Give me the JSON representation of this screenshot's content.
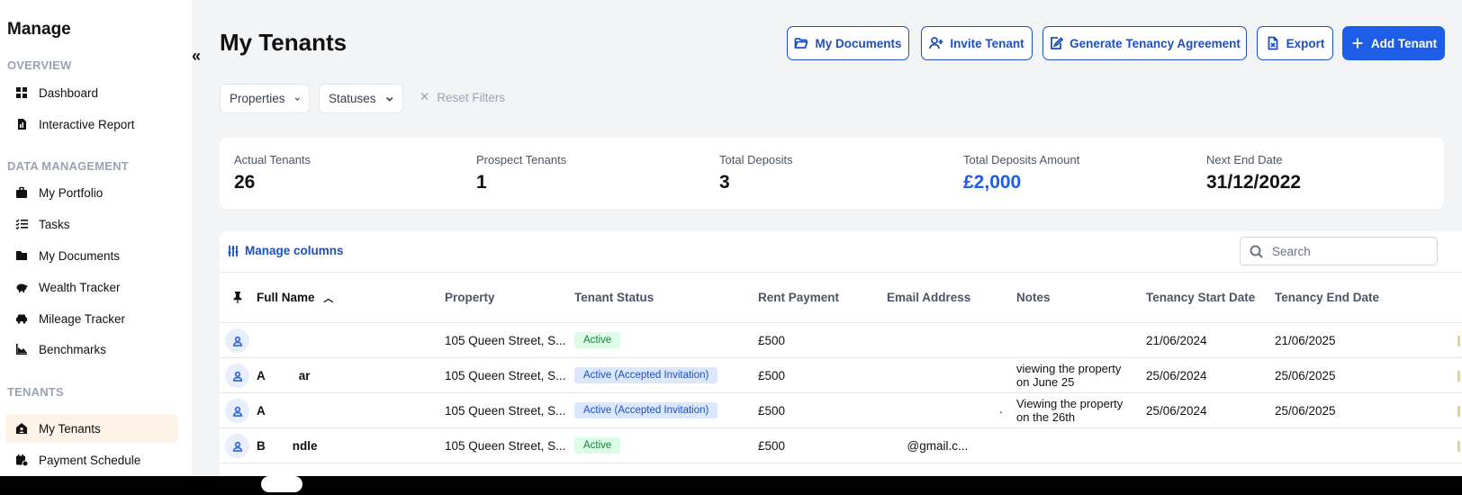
{
  "sidebar": {
    "title": "Manage",
    "sections": {
      "overview": "OVERVIEW",
      "data_management": "DATA MANAGEMENT",
      "tenants": "TENANTS"
    },
    "items": [
      {
        "label": "Dashboard",
        "icon": "grid-icon"
      },
      {
        "label": "Interactive Report",
        "icon": "report-icon"
      },
      {
        "label": "My Portfolio",
        "icon": "briefcase-icon"
      },
      {
        "label": "Tasks",
        "icon": "tasks-icon"
      },
      {
        "label": "My Documents",
        "icon": "folder-icon"
      },
      {
        "label": "Wealth Tracker",
        "icon": "piggy-bank-icon"
      },
      {
        "label": "Mileage Tracker",
        "icon": "car-icon"
      },
      {
        "label": "Benchmarks",
        "icon": "chart-icon"
      },
      {
        "label": "My Tenants",
        "icon": "home-user-icon"
      },
      {
        "label": "Payment Schedule",
        "icon": "calendar-icon"
      }
    ],
    "collapse_glyph": "«"
  },
  "header": {
    "title": "My Tenants",
    "buttons": {
      "my_documents": "My Documents",
      "invite_tenant": "Invite Tenant",
      "generate_agreement": "Generate Tenancy Agreement",
      "export": "Export",
      "add_tenant": "Add Tenant"
    }
  },
  "filters": {
    "properties": "Properties",
    "statuses": "Statuses",
    "reset": "Reset Filters"
  },
  "stats": [
    {
      "label": "Actual Tenants",
      "value": "26"
    },
    {
      "label": "Prospect Tenants",
      "value": "1"
    },
    {
      "label": "Total Deposits",
      "value": "3"
    },
    {
      "label": "Total Deposits Amount",
      "value": "£2,000"
    },
    {
      "label": "Next End Date",
      "value": "31/12/2022"
    }
  ],
  "table": {
    "manage_columns": "Manage columns",
    "search_placeholder": "Search",
    "columns": {
      "full_name": "Full Name",
      "property": "Property",
      "tenant_status": "Tenant Status",
      "rent_payment": "Rent Payment",
      "email": "Email Address",
      "notes": "Notes",
      "start_date": "Tenancy Start Date",
      "end_date": "Tenancy End Date"
    },
    "rows": [
      {
        "name": "",
        "property": "105 Queen Street, S...",
        "status": "Active",
        "rent": "£500",
        "email": "",
        "notes": [
          "",
          ""
        ],
        "start": "21/06/2024",
        "end": "21/06/2025"
      },
      {
        "name": "A          ar",
        "property": "105 Queen Street, S...",
        "status": "Active (Accepted Invitation)",
        "rent": "£500",
        "email": "",
        "notes": [
          "viewing the property",
          "on June 25"
        ],
        "start": "25/06/2024",
        "end": "25/06/2025"
      },
      {
        "name": "A",
        "property": "105 Queen Street, S...",
        "status": "Active (Accepted Invitation)",
        "rent": "£500",
        "email": ".",
        "notes": [
          "Viewing the property",
          "on the 26th"
        ],
        "start": "25/06/2024",
        "end": "25/06/2025"
      },
      {
        "name": "B        ndle",
        "property": "105 Queen Street, S...",
        "status": "Active",
        "rent": "£500",
        "email": "      @gmail.c...",
        "notes": [
          "",
          ""
        ],
        "start": "",
        "end": ""
      }
    ]
  },
  "colors": {
    "primary": "#1d5ee8",
    "outline": "#1e4fbf",
    "active_nav": "#fdf3e7",
    "badge_green": "#dcfce7",
    "badge_blue": "#dbe7fd"
  }
}
